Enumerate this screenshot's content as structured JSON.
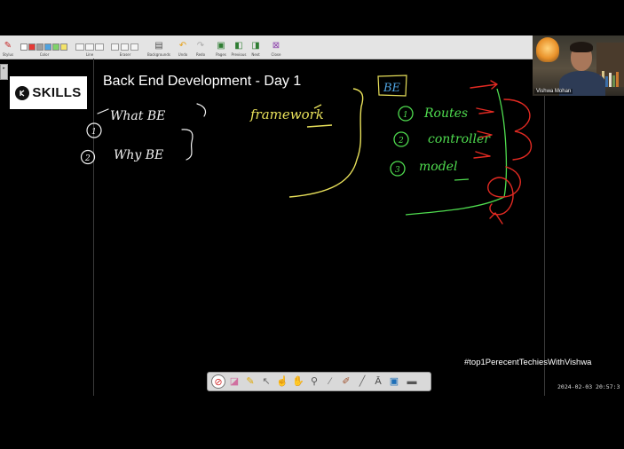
{
  "toolbar": {
    "groups": [
      {
        "id": "stylus",
        "label": "Stylus"
      },
      {
        "id": "color",
        "label": "Color"
      },
      {
        "id": "line",
        "label": "Line"
      },
      {
        "id": "eraser",
        "label": "Eraser"
      },
      {
        "id": "backgrounds",
        "label": "Backgrounds"
      },
      {
        "id": "undo",
        "label": "Undo"
      },
      {
        "id": "redo",
        "label": "Redo"
      },
      {
        "id": "pages",
        "label": "Pages"
      },
      {
        "id": "previous",
        "label": "Previous"
      },
      {
        "id": "next",
        "label": "Next"
      },
      {
        "id": "close",
        "label": "Close"
      }
    ],
    "colors": [
      "#ffffff",
      "#e53935",
      "#9e9e9e",
      "#4fa3e0",
      "#7fd36a",
      "#f3e36a"
    ],
    "side_tab": "▸"
  },
  "logo": {
    "text": "SKILLS"
  },
  "slide": {
    "title": "Back End Development - Day 1"
  },
  "whiteboard": {
    "left_notes": {
      "line1": "What BE",
      "line2": "Why BE",
      "num1": "1",
      "num2": "2",
      "aside": "framework"
    },
    "right_notes": {
      "header": "BE",
      "items": [
        {
          "num": "1",
          "text": "Routes"
        },
        {
          "num": "2",
          "text": "controller"
        },
        {
          "num": "3",
          "text": "model"
        }
      ]
    },
    "ink_colors": {
      "white": "#f2f2f2",
      "yellow": "#e8e05a",
      "green": "#4fdc4f",
      "red": "#e22a22"
    }
  },
  "webcam": {
    "name": "Vishwa Mohan"
  },
  "overlay": {
    "hashtag": "#top1PerecentTechiesWithVishwa",
    "timestamp": "2024-02-03 20:57:3"
  },
  "bottom_toolbar": {
    "tools": [
      "stop-icon",
      "eraser-icon",
      "pen-icon",
      "pointer-icon",
      "hand-pointer-icon",
      "hand-icon",
      "magnifier-icon",
      "wand-icon",
      "brush-icon",
      "line-icon",
      "text-icon",
      "screen-icon",
      "keyboard-icon"
    ]
  }
}
